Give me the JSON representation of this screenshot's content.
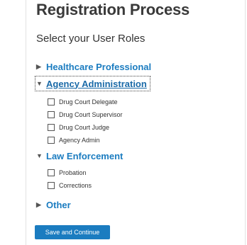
{
  "page": {
    "title": "Registration Process",
    "subtitle": "Select your User Roles"
  },
  "sections": [
    {
      "label": "Healthcare Professional",
      "arrow": "▶",
      "expanded": false,
      "options": []
    },
    {
      "label": "Agency Administration",
      "arrow": "▼",
      "expanded": true,
      "options": [
        {
          "label": "Drug Court Delegate",
          "checked": false
        },
        {
          "label": "Drug Court Supervisor",
          "checked": false
        },
        {
          "label": "Drug Court Judge",
          "checked": false
        },
        {
          "label": "Agency Admin",
          "checked": false
        }
      ]
    },
    {
      "label": "Law Enforcement",
      "arrow": "▼",
      "expanded": true,
      "options": [
        {
          "label": "Probation",
          "checked": false
        },
        {
          "label": "Corrections",
          "checked": false
        }
      ]
    },
    {
      "label": "Other",
      "arrow": "▶",
      "expanded": false,
      "options": []
    }
  ],
  "actions": {
    "save_label": "Save and Continue"
  },
  "colors": {
    "accent": "#1b7cc0",
    "text": "#333333"
  }
}
